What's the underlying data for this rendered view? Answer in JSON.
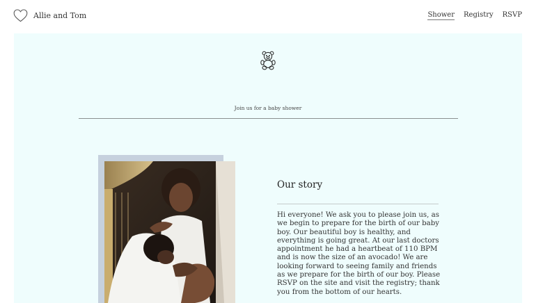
{
  "header": {
    "brand_name": "Allie and Tom",
    "logo_icon": "heart-outline-icon",
    "nav": [
      "Shower",
      "Registry",
      "RSVP"
    ],
    "active_nav": "Shower"
  },
  "hero": {
    "icon": "teddy-bear-icon",
    "tagline": "Join us for a baby shower"
  },
  "story": {
    "title": "Our story",
    "body": "Hi everyone! We ask you to please join us, as we begin to prepare for the birth of our baby boy. Our beautiful boy is healthy, and everything is going great. At our last doctors appointment he had a heartbeat of 110 BPM and is now the size of an avocado! We are looking forward to seeing family and friends as we prepare for the birth of our boy. Please RSVP on the site and visit the registry; thank you from the bottom of our hearts."
  },
  "colors": {
    "panel_bg": "#effdfd",
    "photo_frame": "#c6d1de"
  }
}
